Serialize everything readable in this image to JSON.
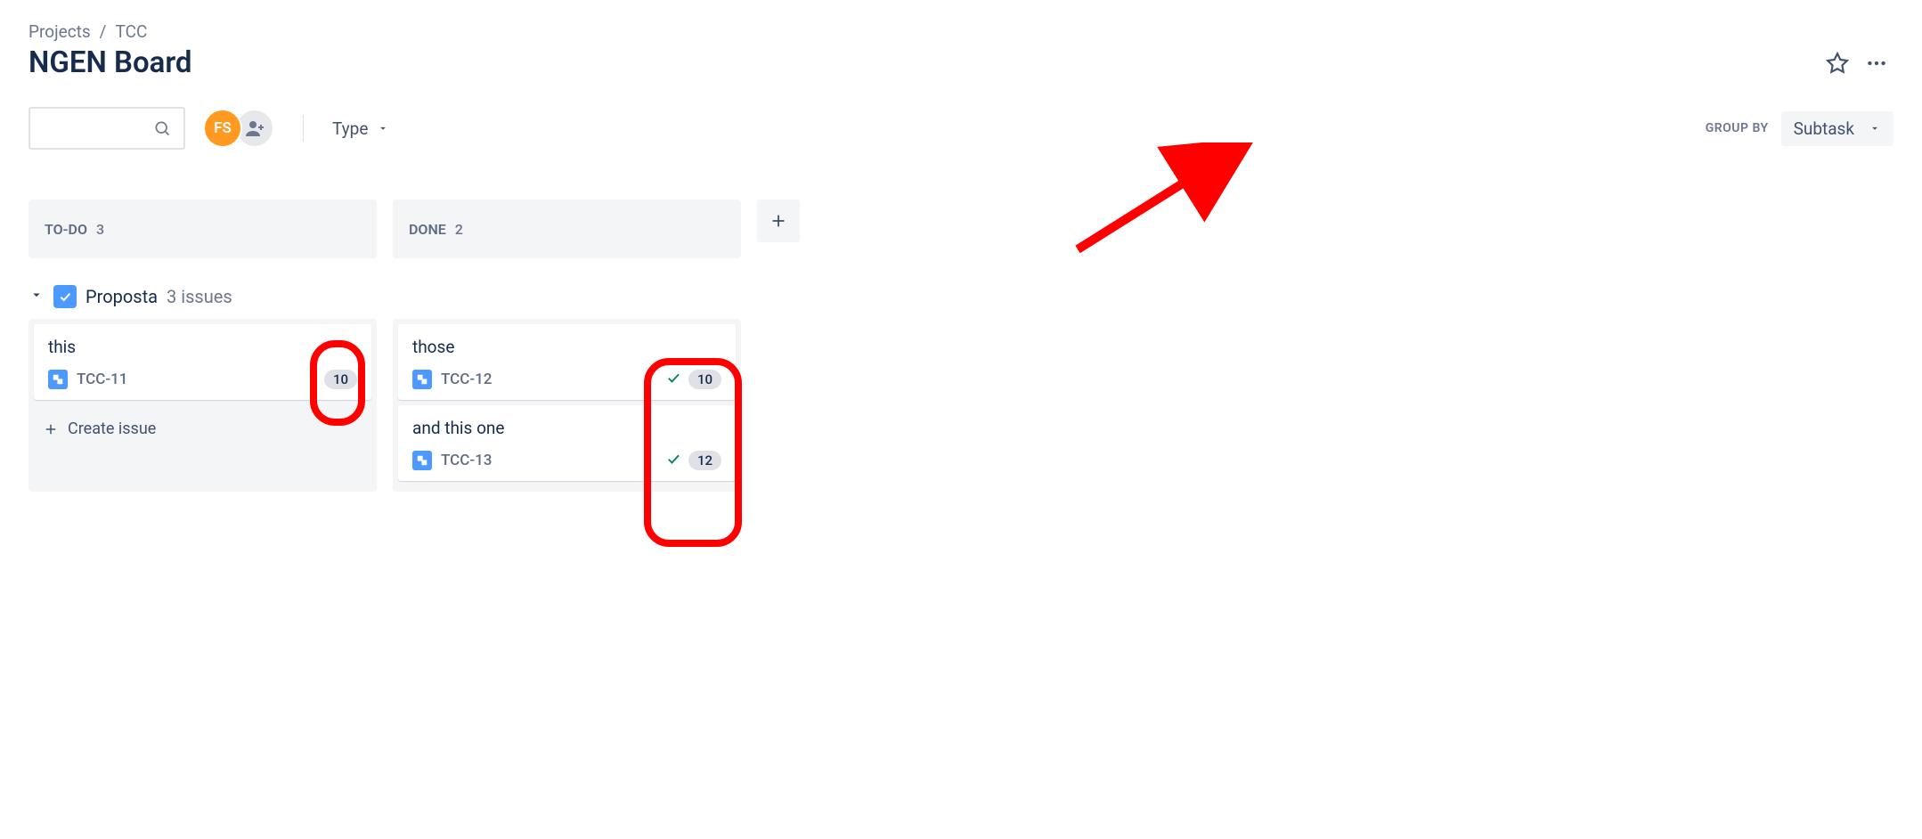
{
  "breadcrumb": {
    "root": "Projects",
    "project": "TCC",
    "separator": "/"
  },
  "board": {
    "title": "NGEN Board"
  },
  "filters": {
    "type_label": "Type",
    "groupby_label": "GROUP BY",
    "groupby_value": "Subtask",
    "avatar_initials": "FS"
  },
  "columns": [
    {
      "name": "TO-DO",
      "count": "3"
    },
    {
      "name": "DONE",
      "count": "2"
    }
  ],
  "swimlane": {
    "title": "Proposta",
    "count_label": "3 issues"
  },
  "cards": {
    "todo": [
      {
        "title": "this",
        "key": "TCC-11",
        "estimate": "10",
        "done": false
      }
    ],
    "done": [
      {
        "title": "those",
        "key": "TCC-12",
        "estimate": "10",
        "done": true
      },
      {
        "title": "and this one",
        "key": "TCC-13",
        "estimate": "12",
        "done": true
      }
    ]
  },
  "actions": {
    "create_issue": "Create issue"
  }
}
